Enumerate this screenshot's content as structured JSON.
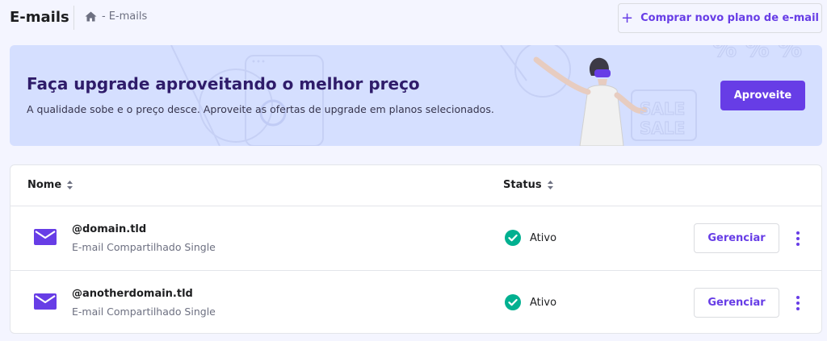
{
  "header": {
    "title": "E-mails",
    "breadcrumb_separator": "-",
    "breadcrumb_current": "E-mails",
    "home_icon": "home-icon",
    "buy_button_label": "Comprar novo plano de e-mail"
  },
  "banner": {
    "title": "Faça upgrade aproveitando o melhor preço",
    "subtitle": "A qualidade sobe e o preço desce. Aproveite as ofertas de upgrade em planos selecionados.",
    "button_label": "Aproveite",
    "decor_text_sale": "SALE",
    "decor_text_percent": "% % %"
  },
  "table": {
    "columns": [
      {
        "label": "Nome"
      },
      {
        "label": "Status"
      }
    ],
    "rows": [
      {
        "domain": "@domain.tld",
        "plan": "E-mail Compartilhado Single",
        "status": "Ativo",
        "action": "Gerenciar"
      },
      {
        "domain": "@anotherdomain.tld",
        "plan": "E-mail Compartilhado Single",
        "status": "Ativo",
        "action": "Gerenciar"
      }
    ]
  },
  "colors": {
    "accent": "#673de6",
    "banner_bg": "#d5dfff",
    "status_ok": "#00b090",
    "page_bg": "#f4f5ff"
  }
}
